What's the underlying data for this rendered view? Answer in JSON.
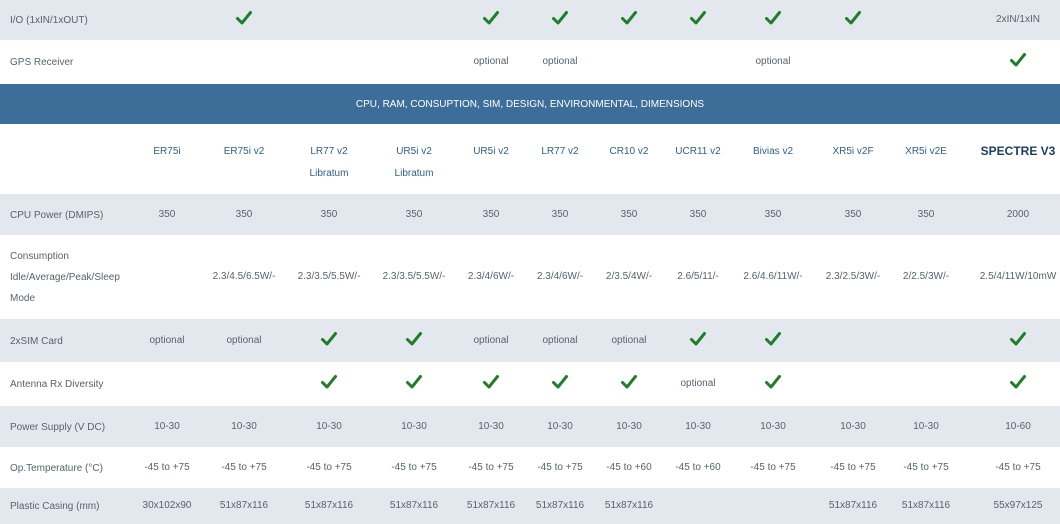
{
  "section_title": "CPU, RAM, CONSUPTION, SIM, DESIGN, ENVIRONMENTAL, DIMENSIONS",
  "products": [
    {
      "name": "ER75i",
      "sub": ""
    },
    {
      "name": "ER75i v2",
      "sub": ""
    },
    {
      "name": "LR77 v2",
      "sub": "Libratum"
    },
    {
      "name": "UR5i v2",
      "sub": "Libratum"
    },
    {
      "name": "UR5i v2",
      "sub": ""
    },
    {
      "name": "LR77 v2",
      "sub": ""
    },
    {
      "name": "CR10 v2",
      "sub": ""
    },
    {
      "name": "UCR11 v2",
      "sub": ""
    },
    {
      "name": "Bivias v2",
      "sub": ""
    },
    {
      "name": "XR5i v2F",
      "sub": ""
    },
    {
      "name": "XR5i v2E",
      "sub": ""
    },
    {
      "name": "SPECTRE V3",
      "sub": ""
    }
  ],
  "top_rows": [
    {
      "label": "I/O (1xIN/1xOUT)",
      "values": [
        "",
        "check",
        "",
        "",
        "check",
        "check",
        "check",
        "check",
        "check",
        "check",
        "",
        "2xIN/1xIN"
      ]
    },
    {
      "label": "GPS Receiver",
      "values": [
        "",
        "",
        "",
        "",
        "optional",
        "optional",
        "",
        "",
        "optional",
        "",
        "",
        "check"
      ]
    }
  ],
  "rows": [
    {
      "label": "CPU Power (DMIPS)",
      "values": [
        "350",
        "350",
        "350",
        "350",
        "350",
        "350",
        "350",
        "350",
        "350",
        "350",
        "350",
        "2000"
      ]
    },
    {
      "label": [
        "Consumption",
        "Idle/Average/Peak/Sleep",
        "Mode"
      ],
      "values": [
        "",
        "2.3/4.5/6.5W/-",
        "2.3/3.5/5.5W/-",
        "2.3/3.5/5.5W/-",
        "2.3/4/6W/-",
        "2.3/4/6W/-",
        "2/3.5/4W/-",
        "2.6/5/11/-",
        "2.6/4.6/11W/-",
        "2.3/2.5/3W/-",
        "2/2.5/3W/-",
        "2.5/4/11W/10mW"
      ]
    },
    {
      "label": "2xSIM Card",
      "values": [
        "optional",
        "optional",
        "check",
        "check",
        "optional",
        "optional",
        "optional",
        "check",
        "check",
        "",
        "",
        "check"
      ]
    },
    {
      "label": "Antenna Rx Diversity",
      "values": [
        "",
        "",
        "check",
        "check",
        "check",
        "check",
        "check",
        "optional",
        "check",
        "",
        "",
        "check"
      ]
    },
    {
      "label": "Power Supply (V DC)",
      "values": [
        "10-30",
        "10-30",
        "10-30",
        "10-30",
        "10-30",
        "10-30",
        "10-30",
        "10-30",
        "10-30",
        "10-30",
        "10-30",
        "10-60"
      ]
    },
    {
      "label": "Op.Temperature (°C)",
      "values": [
        "-45 to +75",
        "-45 to +75",
        "-45 to +75",
        "-45 to +75",
        "-45 to +75",
        "-45 to +75",
        "-45 to +60",
        "-45 to +60",
        "-45 to +75",
        "-45 to +75",
        "-45 to +75",
        "-45 to +75"
      ]
    },
    {
      "label": "Plastic Casing (mm)",
      "values": [
        "30x102x90",
        "51x87x116",
        "51x87x116",
        "51x87x116",
        "51x87x116",
        "51x87x116",
        "51x87x116",
        "",
        "",
        "51x87x116",
        "51x87x116",
        "55x97x125"
      ]
    }
  ],
  "colors": {
    "check": "#1e7e2a",
    "section_bar": "#3d6e99",
    "row_shade": "#e3e8ee"
  }
}
